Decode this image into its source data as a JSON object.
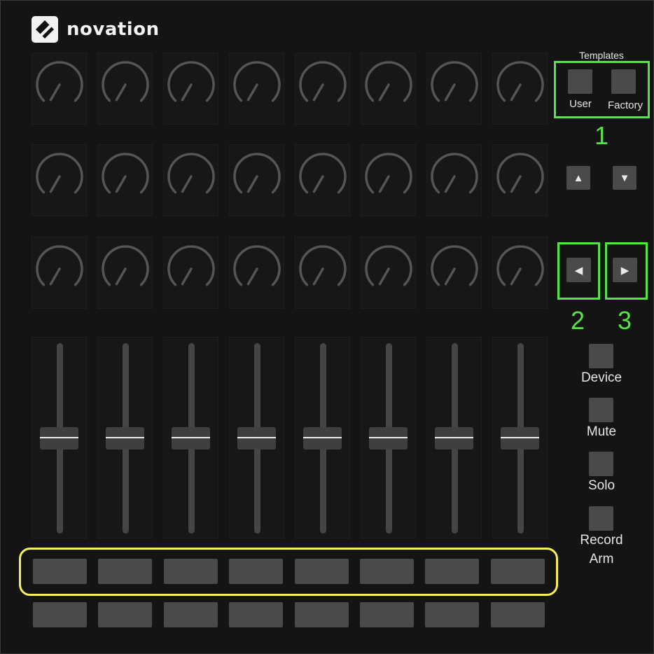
{
  "logo": {
    "brand": "novation"
  },
  "templates": {
    "title": "Templates",
    "user_label": "User",
    "factory_label": "Factory"
  },
  "arrows": {
    "up": "▲",
    "down": "▼",
    "left": "◀",
    "right": "▶"
  },
  "side_buttons": [
    {
      "id": "device",
      "lines": [
        "Device"
      ]
    },
    {
      "id": "mute",
      "lines": [
        "Mute"
      ]
    },
    {
      "id": "solo",
      "lines": [
        "Solo"
      ]
    },
    {
      "id": "record-arm",
      "lines": [
        "Record",
        "Arm"
      ]
    }
  ],
  "annotations": {
    "templates_marker": "1",
    "left_marker": "2",
    "right_marker": "3"
  },
  "knobs": {
    "rows": 3,
    "columns": 8
  },
  "faders": {
    "count": 8,
    "level": 0.5
  },
  "pads": {
    "rows": 2,
    "columns": 8
  },
  "colors": {
    "annotation_green": "#57e246",
    "highlight_yellow": "#f4f05a",
    "control_gray": "#4a4a4a"
  }
}
